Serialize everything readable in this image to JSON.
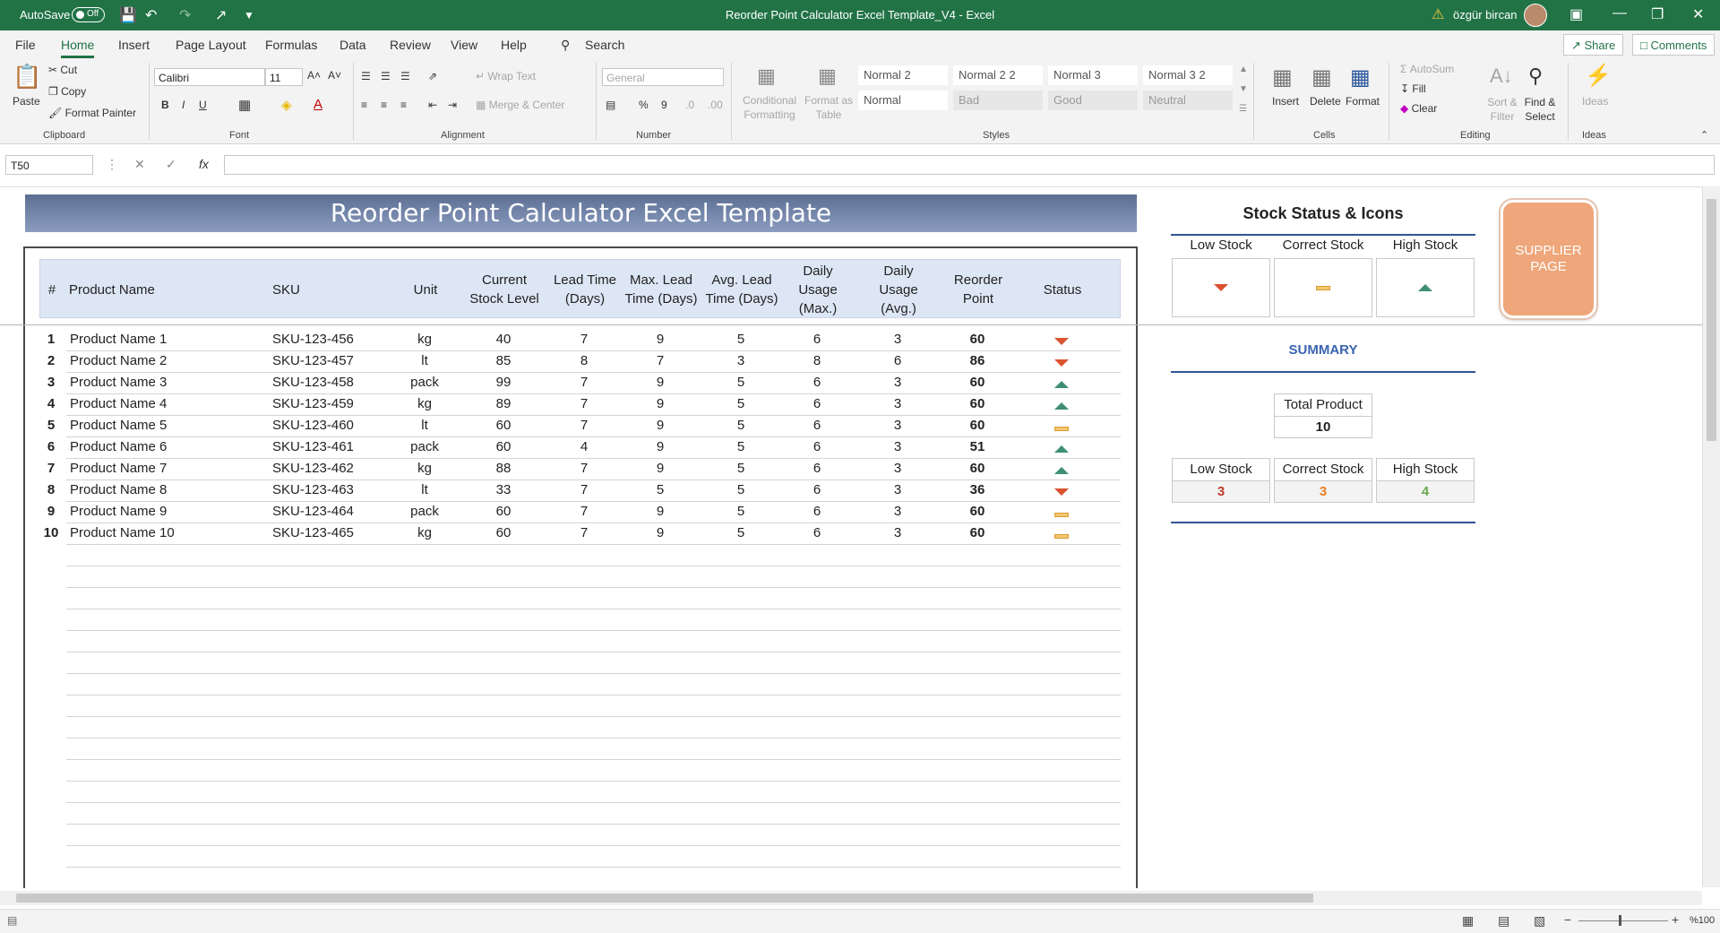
{
  "titlebar": {
    "autosave_label": "AutoSave",
    "autosave_state": "Off",
    "doc_title": "Reorder Point Calculator Excel Template_V4  -  Excel",
    "user": "özgür bircan"
  },
  "menu": {
    "items": [
      "File",
      "Home",
      "Insert",
      "Page Layout",
      "Formulas",
      "Data",
      "Review",
      "View",
      "Help"
    ],
    "search": "Search",
    "share": "Share",
    "comments": "Comments"
  },
  "ribbon": {
    "clipboard": {
      "paste": "Paste",
      "cut": "Cut",
      "copy": "Copy",
      "format_painter": "Format Painter",
      "label": "Clipboard"
    },
    "font": {
      "name": "Calibri",
      "size": "11",
      "label": "Font"
    },
    "alignment": {
      "wrap_text": "Wrap Text",
      "merge_center": "Merge & Center",
      "label": "Alignment"
    },
    "number": {
      "format": "General",
      "label": "Number"
    },
    "styles": {
      "conditional": "Conditional Formatting",
      "format_as_table": "Format as Table",
      "cells": [
        "Normal 2",
        "Normal 2 2",
        "Normal 3",
        "Normal 3 2",
        "Normal",
        "Bad",
        "Good",
        "Neutral"
      ],
      "label": "Styles"
    },
    "cells": {
      "insert": "Insert",
      "delete": "Delete",
      "format": "Format",
      "label": "Cells"
    },
    "editing": {
      "autosum": "AutoSum",
      "fill": "Fill",
      "clear": "Clear",
      "sort_filter": "Sort & Filter",
      "find_select": "Find & Select",
      "label": "Editing"
    },
    "ideas": {
      "ideas": "Ideas",
      "label": "Ideas"
    }
  },
  "formula_bar": {
    "name_box": "T50",
    "fx": "fx",
    "formula": ""
  },
  "sheet": {
    "title": "Reorder Point Calculator Excel Template",
    "headers": {
      "num": "#",
      "product": "Product Name",
      "sku": "SKU",
      "unit": "Unit",
      "current": "Current Stock Level",
      "lead": "Lead Time (Days)",
      "max_lead": "Max. Lead Time (Days)",
      "avg_lead": "Avg. Lead Time (Days)",
      "daily_max": "Daily Usage (Max.)",
      "daily_avg": "Daily Usage (Avg.)",
      "reorder": "Reorder Point",
      "status": "Status"
    },
    "rows": [
      {
        "n": "1",
        "product": "Product Name 1",
        "sku": "SKU-123-456",
        "unit": "kg",
        "current": "40",
        "lead": "7",
        "max_lead": "9",
        "avg_lead": "5",
        "daily_max": "6",
        "daily_avg": "3",
        "reorder": "60",
        "status": "low"
      },
      {
        "n": "2",
        "product": "Product Name 2",
        "sku": "SKU-123-457",
        "unit": "lt",
        "current": "85",
        "lead": "8",
        "max_lead": "7",
        "avg_lead": "3",
        "daily_max": "8",
        "daily_avg": "6",
        "reorder": "86",
        "status": "low"
      },
      {
        "n": "3",
        "product": "Product Name 3",
        "sku": "SKU-123-458",
        "unit": "pack",
        "current": "99",
        "lead": "7",
        "max_lead": "9",
        "avg_lead": "5",
        "daily_max": "6",
        "daily_avg": "3",
        "reorder": "60",
        "status": "high"
      },
      {
        "n": "4",
        "product": "Product Name 4",
        "sku": "SKU-123-459",
        "unit": "kg",
        "current": "89",
        "lead": "7",
        "max_lead": "9",
        "avg_lead": "5",
        "daily_max": "6",
        "daily_avg": "3",
        "reorder": "60",
        "status": "high"
      },
      {
        "n": "5",
        "product": "Product Name 5",
        "sku": "SKU-123-460",
        "unit": "lt",
        "current": "60",
        "lead": "7",
        "max_lead": "9",
        "avg_lead": "5",
        "daily_max": "6",
        "daily_avg": "3",
        "reorder": "60",
        "status": "correct"
      },
      {
        "n": "6",
        "product": "Product Name 6",
        "sku": "SKU-123-461",
        "unit": "pack",
        "current": "60",
        "lead": "4",
        "max_lead": "9",
        "avg_lead": "5",
        "daily_max": "6",
        "daily_avg": "3",
        "reorder": "51",
        "status": "high"
      },
      {
        "n": "7",
        "product": "Product Name 7",
        "sku": "SKU-123-462",
        "unit": "kg",
        "current": "88",
        "lead": "7",
        "max_lead": "9",
        "avg_lead": "5",
        "daily_max": "6",
        "daily_avg": "3",
        "reorder": "60",
        "status": "high"
      },
      {
        "n": "8",
        "product": "Product Name 8",
        "sku": "SKU-123-463",
        "unit": "lt",
        "current": "33",
        "lead": "7",
        "max_lead": "5",
        "avg_lead": "5",
        "daily_max": "6",
        "daily_avg": "3",
        "reorder": "36",
        "status": "low"
      },
      {
        "n": "9",
        "product": "Product Name 9",
        "sku": "SKU-123-464",
        "unit": "pack",
        "current": "60",
        "lead": "7",
        "max_lead": "9",
        "avg_lead": "5",
        "daily_max": "6",
        "daily_avg": "3",
        "reorder": "60",
        "status": "correct"
      },
      {
        "n": "10",
        "product": "Product Name 10",
        "sku": "SKU-123-465",
        "unit": "kg",
        "current": "60",
        "lead": "7",
        "max_lead": "9",
        "avg_lead": "5",
        "daily_max": "6",
        "daily_avg": "3",
        "reorder": "60",
        "status": "correct"
      }
    ]
  },
  "panel": {
    "title": "Stock Status & Icons",
    "low": "Low Stock",
    "correct": "Correct Stock",
    "high": "High Stock",
    "supplier_button": "SUPPLIER PAGE",
    "summary_title": "SUMMARY",
    "total_label": "Total Product",
    "total_value": "10",
    "low_value": "3",
    "correct_value": "3",
    "high_value": "4",
    "colors": {
      "low": "#c0392b",
      "correct": "#e67e22",
      "high": "#6aa84f"
    }
  },
  "statusbar": {
    "zoom": "%100"
  }
}
